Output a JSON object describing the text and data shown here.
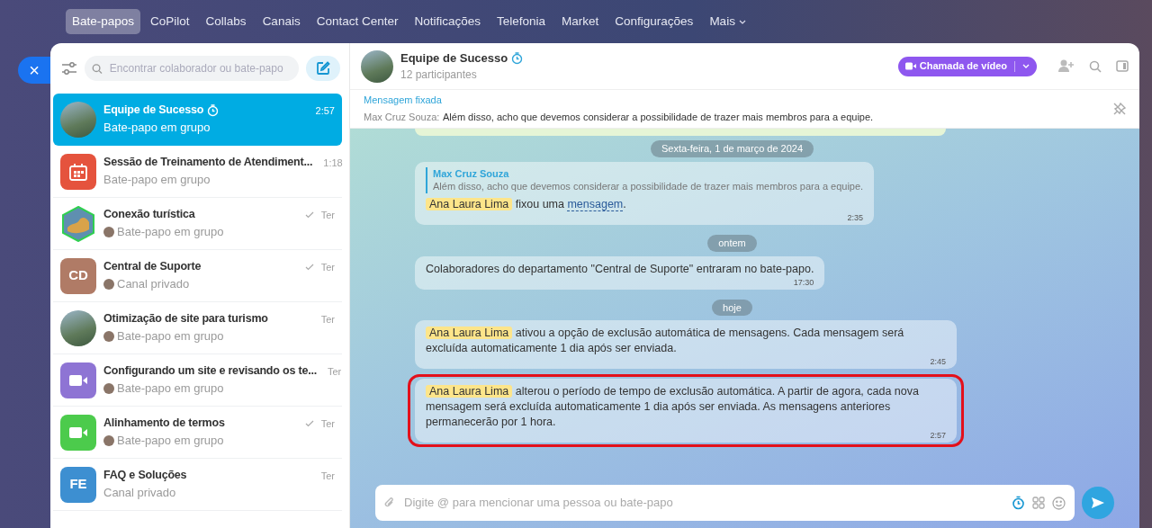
{
  "top_nav": {
    "items": [
      {
        "label": "Bate-papos",
        "selected": true
      },
      {
        "label": "CoPilot",
        "selected": false
      },
      {
        "label": "Collabs",
        "selected": false
      },
      {
        "label": "Canais",
        "selected": false
      },
      {
        "label": "Contact Center",
        "selected": false
      },
      {
        "label": "Notificações",
        "selected": false
      },
      {
        "label": "Telefonia",
        "selected": false
      },
      {
        "label": "Market",
        "selected": false
      },
      {
        "label": "Configurações",
        "selected": false
      }
    ],
    "more": "Mais"
  },
  "close_button": "×",
  "sidebar": {
    "search": {
      "placeholder": "Encontrar colaborador ou bate-papo"
    },
    "chats": [
      {
        "name": "Equipe de Sucesso",
        "subtitle": "Bate-papo em grupo",
        "time": "2:57",
        "avatar": {
          "kind": "photo"
        },
        "timer": true,
        "read": false,
        "sender_avatar": false,
        "selected": true
      },
      {
        "name": "Sessão de Treinamento de Atendiment...",
        "subtitle": "Bate-papo em grupo",
        "time": "1:18",
        "avatar": {
          "kind": "calendar",
          "color": "#e5533d"
        },
        "timer": false,
        "read": false,
        "sender_avatar": false,
        "selected": false
      },
      {
        "name": "Conexão turística",
        "subtitle": "Bate-papo em grupo",
        "time": "Ter",
        "avatar": {
          "kind": "hexagon"
        },
        "timer": false,
        "read": true,
        "sender_avatar": true,
        "selected": false
      },
      {
        "name": "Central de Suporte",
        "subtitle": "Canal privado",
        "time": "Ter",
        "avatar": {
          "kind": "initials",
          "text": "CD",
          "color": "#b07b66"
        },
        "timer": false,
        "read": true,
        "sender_avatar": true,
        "selected": false
      },
      {
        "name": "Otimização de site para turismo",
        "subtitle": "Bate-papo em grupo",
        "time": "Ter",
        "avatar": {
          "kind": "photo"
        },
        "timer": false,
        "read": false,
        "sender_avatar": true,
        "selected": false
      },
      {
        "name": "Configurando um site e revisando os te...",
        "subtitle": "Bate-papo em grupo",
        "time": "Ter",
        "avatar": {
          "kind": "video",
          "color": "#8e74d4"
        },
        "timer": false,
        "read": false,
        "sender_avatar": true,
        "selected": false
      },
      {
        "name": "Alinhamento de termos",
        "subtitle": "Bate-papo em grupo",
        "time": "Ter",
        "avatar": {
          "kind": "video",
          "color": "#4ccb4c"
        },
        "timer": false,
        "read": true,
        "sender_avatar": true,
        "selected": false
      },
      {
        "name": "FAQ e Soluções",
        "subtitle": "Canal privado",
        "time": "Ter",
        "avatar": {
          "kind": "initials",
          "text": "FE",
          "color": "#3d8fd1"
        },
        "timer": false,
        "read": false,
        "sender_avatar": false,
        "selected": false
      }
    ]
  },
  "chat": {
    "title": "Equipe de Sucesso",
    "timer": true,
    "members": "12 participantes",
    "video_button": "Chamada de vídeo",
    "pinned": {
      "label": "Mensagem fixada",
      "author": "Max Cruz Souza:",
      "text": "Além disso, acho que devemos considerar a possibilidade de trazer mais membros para a equipe."
    },
    "messages": [
      {
        "kind": "date",
        "text": "Sexta-feira, 1 de março de 2024"
      },
      {
        "kind": "pin",
        "quote_author": "Max Cruz Souza",
        "quote_text": "Além disso, acho que devemos considerar a possibilidade de trazer mais membros para a equipe.",
        "actor": "Ana Laura Lima",
        "text": "fixou uma",
        "link": "mensagem",
        "tail": ".",
        "time": "2:35",
        "highlighted": false
      },
      {
        "kind": "date",
        "text": "ontem"
      },
      {
        "kind": "system",
        "text": "Colaboradores do departamento \"Central de Suporte\" entraram no bate-papo.",
        "time": "17:30",
        "highlighted": false
      },
      {
        "kind": "date",
        "text": "hoje"
      },
      {
        "kind": "system",
        "actor": "Ana Laura Lima",
        "text": "ativou a opção de exclusão automática de mensagens. Cada mensagem será excluída automaticamente 1 dia após ser enviada.",
        "time": "2:45",
        "highlighted": false
      },
      {
        "kind": "system",
        "actor": "Ana Laura Lima",
        "text": "alterou o período de tempo de exclusão automática. A partir de agora, cada nova mensagem será excluída automaticamente 1 dia após ser enviada. As mensagens anteriores permanecerão por 1 hora.",
        "time": "2:57",
        "highlighted": true
      }
    ],
    "input": {
      "placeholder": "Digite @ para mencionar uma pessoa ou bate-papo"
    }
  }
}
